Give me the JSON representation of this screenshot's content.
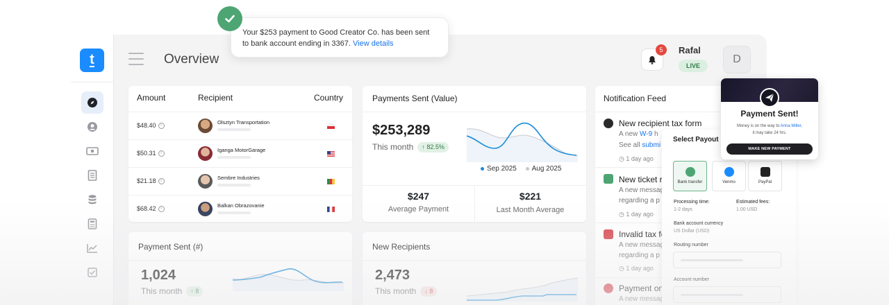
{
  "toast": {
    "message": "Your $253 payment to Good Creator Co. has been sent to bank account ending in 3367.",
    "link": "View details"
  },
  "header": {
    "title": "Overview",
    "notification_count": "5",
    "user_name": "Rafal",
    "status": "LIVE",
    "avatar_letter": "D"
  },
  "logo": {
    "letter": "t",
    "color": "#1a8cff"
  },
  "sidebar": {
    "items": [
      {
        "icon": "compass-icon",
        "active": true
      },
      {
        "icon": "user-icon"
      },
      {
        "icon": "cash-icon"
      },
      {
        "icon": "document-icon"
      },
      {
        "icon": "database-icon"
      },
      {
        "icon": "calculator-icon"
      },
      {
        "icon": "chart-icon"
      },
      {
        "icon": "checkbox-icon"
      }
    ]
  },
  "payments_table": {
    "headers": {
      "amount": "Amount",
      "recipient": "Recipient",
      "country": "Country"
    },
    "rows": [
      {
        "amount": "$48.40",
        "recipient": "Olsztyn Transportation",
        "flag": "Poland"
      },
      {
        "amount": "$50.31",
        "recipient": "Iganga MotorGarage",
        "flag": "United States"
      },
      {
        "amount": "$21.18",
        "recipient": "Sembre Industries",
        "flag": "Cameroon"
      },
      {
        "amount": "$68.42",
        "recipient": "Balkan Obrazovanie",
        "flag": "France"
      }
    ]
  },
  "payments_value": {
    "title": "Payments Sent (Value)",
    "value": "$253,289",
    "period": "This month",
    "change": "↑ 82.5%",
    "legend": [
      "Sep 2025",
      "Aug 2025"
    ],
    "series_colors": [
      "#1a8cd8",
      "#c8c8cc"
    ],
    "avg_value": "$247",
    "avg_label": "Average Payment",
    "last_value": "$221",
    "last_label": "Last Month Average"
  },
  "payment_sent_count": {
    "title": "Payment Sent (#)",
    "value": "1,024",
    "period": "This month",
    "change": "↑ 8"
  },
  "new_recipients": {
    "title": "New Recipients",
    "value": "2,473",
    "period": "This month",
    "change": "↓ 8"
  },
  "notification_feed": {
    "title": "Notification Feed",
    "items": [
      {
        "title": "New recipient tax form",
        "line1_pre": "A new ",
        "line1_link": "W-9",
        "line1_post": " h",
        "line2_pre": "See all ",
        "line2_link": "submi",
        "time": "1 day ago",
        "icon": "tax-form-icon"
      },
      {
        "title": "New ticket r",
        "line1": "A new messag",
        "line2": "regarding a p",
        "time": "1 day ago",
        "icon": "chat-icon"
      },
      {
        "title": "Invalid tax fo",
        "line1": "A new messag",
        "line2": "regarding a p",
        "time": "1 day ago",
        "icon": "alert-checkbox-icon"
      },
      {
        "title": "Payment on",
        "line1": "A new messag",
        "icon": "dollar-icon"
      }
    ]
  },
  "payout_panel": {
    "title": "Select Payout M",
    "methods": [
      {
        "label": "Bank transfer",
        "selected": true
      },
      {
        "label": "Venmo"
      },
      {
        "label": "PayPal"
      }
    ],
    "processing_label": "Processing time:",
    "processing_value": "1-2 days",
    "fees_label": "Estimated fees:",
    "fees_value": "1.00 USD",
    "currency_label": "Bank account currency",
    "currency_value": "US Dollar (USD)",
    "routing_label": "Routing number",
    "account_label": "Account number"
  },
  "payment_sent_card": {
    "title": "Payment Sent!",
    "line1_pre": "Money is on the way to ",
    "line1_link": "Anna Miller,",
    "line2": "it may take 24 hrs.",
    "button": "MAKE NEW PAYMENT"
  }
}
